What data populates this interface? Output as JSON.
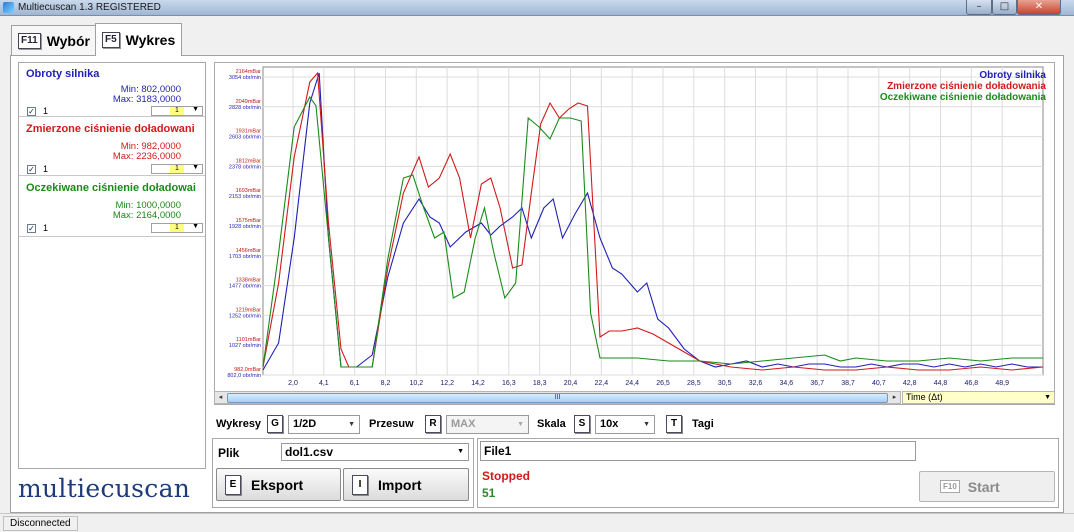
{
  "window": {
    "title": "Multiecuscan 1.3 REGISTERED"
  },
  "tabs": [
    {
      "key": "F11",
      "label": "Wybór"
    },
    {
      "key": "F5",
      "label": "Wykres"
    }
  ],
  "signals": [
    {
      "name": "Obroty silnika",
      "min": "Min: 802,0000",
      "max": "Max: 3183,0000",
      "index": "1",
      "color_index": "1",
      "color": "#1f1fb5"
    },
    {
      "name": "Zmierzone ciśnienie doładowani",
      "min": "Min: 982,0000",
      "max": "Max: 2236,0000",
      "index": "1",
      "color_index": "1",
      "color": "#d21a1a"
    },
    {
      "name": "Oczekiwane ciśnienie doładowai",
      "min": "Min: 1000,0000",
      "max": "Max: 2164,0000",
      "index": "1",
      "color_index": "1",
      "color": "#1b8a1b"
    }
  ],
  "chart_data": {
    "type": "line",
    "legend": [
      "Obroty silnika",
      "Zmierzone ciśnienie doładowania",
      "Oczekiwane ciśnienie doładowania"
    ],
    "legend_position": "top-right",
    "xticks": [
      "2,0",
      "4,1",
      "6,1",
      "8,2",
      "10,2",
      "12,2",
      "14,2",
      "16,3",
      "18,3",
      "20,4",
      "22,4",
      "24,4",
      "26,5",
      "28,5",
      "30,5",
      "32,6",
      "34,6",
      "36,7",
      "38,7",
      "40,7",
      "42,8",
      "44,8",
      "46,8",
      "48,9"
    ],
    "yticks_pressure": [
      "2164mBar",
      "2049mBar",
      "1931mBar",
      "1812mBar",
      "1693mBar",
      "1575mBar",
      "1456mBar",
      "1338mBar",
      "1219mBar",
      "1101mBar",
      "982,0mBar"
    ],
    "yticks_rpm": [
      "3054 obr/min",
      "2828 obr/min",
      "2603 obr/min",
      "2378 obr/min",
      "2153 obr/min",
      "1928 obr/min",
      "1703 obr/min",
      "1477 obr/min",
      "1252 obr/min",
      "1027 obr/min",
      "802,0 obr/min"
    ],
    "grid": true,
    "xlim": [
      0,
      50
    ],
    "series": [
      {
        "name": "Obroty silnika",
        "color": "#1f1fb5",
        "x": [
          0,
          1,
          2,
          3,
          3.6,
          4.2,
          5,
          5.5,
          6,
          7,
          8,
          9,
          10,
          10.7,
          11.3,
          12,
          13,
          14,
          14.6,
          15.2,
          16,
          16.6,
          17.2,
          18,
          18.6,
          19.2,
          20,
          20.8,
          21.6,
          22.4,
          23,
          24,
          24.6,
          25.3,
          26,
          27,
          28,
          29,
          30,
          31,
          32,
          33,
          34,
          35,
          36,
          37,
          38,
          39,
          40,
          41,
          42,
          43,
          44,
          45,
          46,
          47,
          48,
          49,
          50
        ],
        "y": [
          0.01,
          0.1,
          0.45,
          0.9,
          1.0,
          0.45,
          0.02,
          0.02,
          0.02,
          0.06,
          0.32,
          0.5,
          0.58,
          0.52,
          0.5,
          0.42,
          0.47,
          0.5,
          0.46,
          0.49,
          0.52,
          0.55,
          0.45,
          0.55,
          0.58,
          0.45,
          0.53,
          0.6,
          0.45,
          0.35,
          0.33,
          0.27,
          0.3,
          0.18,
          0.15,
          0.08,
          0.04,
          0.02,
          0.03,
          0.04,
          0.02,
          0.03,
          0.02,
          0.03,
          0.03,
          0.02,
          0.02,
          0.03,
          0.02,
          0.03,
          0.03,
          0.02,
          0.03,
          0.02,
          0.03,
          0.02,
          0.03,
          0.02,
          0.02
        ]
      },
      {
        "name": "Zmierzone ciśnienie doładowania",
        "color": "#d21a1a",
        "x": [
          0,
          1,
          2,
          3,
          3.5,
          4.2,
          5,
          5.5,
          6,
          7,
          8,
          9,
          10,
          10.6,
          11.3,
          12,
          12.6,
          13.3,
          14,
          14.6,
          15.2,
          16,
          16.6,
          17.2,
          17.8,
          18.4,
          19,
          19.6,
          20.2,
          20.8,
          21.6,
          22.2,
          23,
          24,
          25,
          26,
          27,
          28,
          29,
          30,
          32,
          34,
          36,
          38,
          40,
          42,
          44,
          46,
          48,
          50
        ],
        "y": [
          0.02,
          0.3,
          0.72,
          0.97,
          1.0,
          0.5,
          0.08,
          0.02,
          0.02,
          0.02,
          0.35,
          0.6,
          0.72,
          0.62,
          0.65,
          0.73,
          0.65,
          0.45,
          0.63,
          0.65,
          0.55,
          0.35,
          0.36,
          0.6,
          0.83,
          0.9,
          0.85,
          0.88,
          0.9,
          0.89,
          0.12,
          0.14,
          0.14,
          0.15,
          0.13,
          0.1,
          0.07,
          0.04,
          0.03,
          0.02,
          0.01,
          0.02,
          0.01,
          0.01,
          0.02,
          0.01,
          0.01,
          0.02,
          0.01,
          0.02
        ]
      },
      {
        "name": "Oczekiwane ciśnienie doładowania",
        "color": "#1b8a1b",
        "x": [
          0,
          1,
          2,
          3,
          3.4,
          4.2,
          5,
          5.5,
          6,
          7,
          8,
          9,
          9.6,
          10.3,
          11,
          11.6,
          12.2,
          12.9,
          13.6,
          14.2,
          14.8,
          15.5,
          16.2,
          17,
          17.7,
          18.4,
          19,
          19.7,
          20.4,
          21,
          21.6,
          22.2,
          23,
          24,
          26,
          28,
          30,
          32,
          34,
          36,
          37,
          38,
          40,
          42,
          44,
          46,
          48,
          50
        ],
        "y": [
          0.02,
          0.4,
          0.82,
          0.92,
          0.89,
          0.45,
          0.02,
          0.02,
          0.02,
          0.02,
          0.38,
          0.65,
          0.66,
          0.55,
          0.45,
          0.47,
          0.25,
          0.27,
          0.45,
          0.55,
          0.4,
          0.25,
          0.3,
          0.85,
          0.82,
          0.78,
          0.85,
          0.85,
          0.84,
          0.2,
          0.05,
          0.05,
          0.05,
          0.05,
          0.04,
          0.04,
          0.03,
          0.04,
          0.05,
          0.06,
          0.04,
          0.05,
          0.04,
          0.04,
          0.05,
          0.04,
          0.05,
          0.05
        ]
      }
    ]
  },
  "scroll": {
    "thumb_label": "III",
    "left_arrow": "◂",
    "right_arrow": "▸"
  },
  "time_select": {
    "value": "Time (Δt)"
  },
  "controls": {
    "wykresy_label": "Wykresy",
    "wykresy_key": "G",
    "wykresy_value": "1/2D",
    "przesuw_label": "Przesuw",
    "przesuw_key": "R",
    "przesuw_value": "MAX",
    "skala_label": "Skala",
    "skala_key": "S",
    "skala_value": "10x",
    "tagi_key": "T",
    "tagi_label": "Tagi"
  },
  "plik": {
    "label": "Plik",
    "value": "dol1.csv"
  },
  "buttons": {
    "eksport_key": "E",
    "eksport_label": "Eksport",
    "import_key": "I",
    "import_label": "Import",
    "start_key": "F10",
    "start_label": "Start"
  },
  "file_status": {
    "file": "File1",
    "status": "Stopped",
    "count": "51"
  },
  "logo": "multiecuscan",
  "statusbar": {
    "text": "Disconnected"
  }
}
